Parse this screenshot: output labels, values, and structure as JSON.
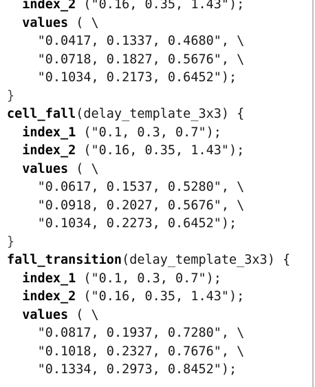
{
  "lines": [
    {
      "indent": "  ",
      "keyword": "index_2",
      "rest": " (\"0.16, 0.35, 1.43\");"
    },
    {
      "indent": "  ",
      "keyword": "values",
      "rest": " ( \\"
    },
    {
      "indent": "    ",
      "keyword": "",
      "rest": "\"0.0417, 0.1337, 0.4680\", \\"
    },
    {
      "indent": "    ",
      "keyword": "",
      "rest": "\"0.0718, 0.1827, 0.5676\", \\"
    },
    {
      "indent": "    ",
      "keyword": "",
      "rest": "\"0.1034, 0.2173, 0.6452\");"
    },
    {
      "indent": "",
      "keyword": "",
      "rest": "}"
    },
    {
      "indent": "",
      "keyword": "cell_fall",
      "rest": "(delay_template_3x3) {"
    },
    {
      "indent": "  ",
      "keyword": "index_1",
      "rest": " (\"0.1, 0.3, 0.7\");"
    },
    {
      "indent": "  ",
      "keyword": "index_2",
      "rest": " (\"0.16, 0.35, 1.43\");"
    },
    {
      "indent": "  ",
      "keyword": "values",
      "rest": " ( \\"
    },
    {
      "indent": "    ",
      "keyword": "",
      "rest": "\"0.0617, 0.1537, 0.5280\", \\"
    },
    {
      "indent": "    ",
      "keyword": "",
      "rest": "\"0.0918, 0.2027, 0.5676\", \\"
    },
    {
      "indent": "    ",
      "keyword": "",
      "rest": "\"0.1034, 0.2273, 0.6452\");"
    },
    {
      "indent": "",
      "keyword": "",
      "rest": "}"
    },
    {
      "indent": "",
      "keyword": "fall_transition",
      "rest": "(delay_template_3x3) {"
    },
    {
      "indent": "  ",
      "keyword": "index_1",
      "rest": " (\"0.1, 0.3, 0.7\");"
    },
    {
      "indent": "  ",
      "keyword": "index_2",
      "rest": " (\"0.16, 0.35, 1.43\");"
    },
    {
      "indent": "  ",
      "keyword": "values",
      "rest": " ( \\"
    },
    {
      "indent": "    ",
      "keyword": "",
      "rest": "\"0.0817, 0.1937, 0.7280\", \\"
    },
    {
      "indent": "    ",
      "keyword": "",
      "rest": "\"0.1018, 0.2327, 0.7676\", \\"
    },
    {
      "indent": "    ",
      "keyword": "",
      "rest": "\"0.1334, 0.2973, 0.8452\");"
    }
  ]
}
